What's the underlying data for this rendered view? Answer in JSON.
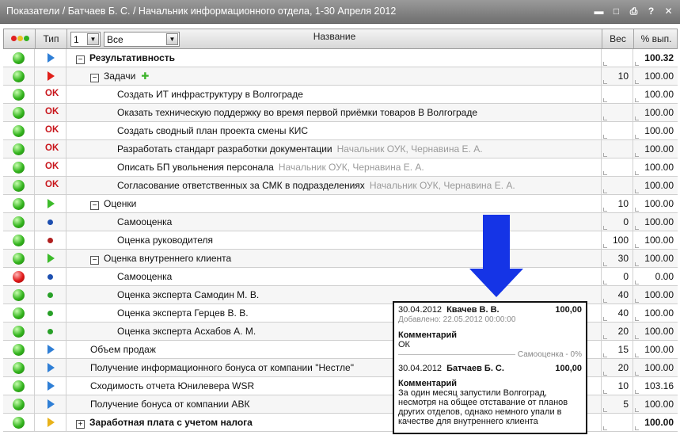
{
  "window": {
    "title": "Показатели / Батчаев Б. С. / Начальник информационного отдела, 1-30 Апреля 2012",
    "controls": [
      "▬",
      "□",
      "⎙",
      "?",
      "✕"
    ]
  },
  "header": {
    "type_label": "Тип",
    "level_value": "1",
    "filter_value": "Все",
    "name_label": "Название",
    "weight_label": "Вес",
    "pct_label": "% вып."
  },
  "rows": [
    {
      "status": "green",
      "type": "flag-blue",
      "level": 0,
      "toggle": "−",
      "name": "Результативность",
      "bold": true,
      "weight": "",
      "pct": "100.32",
      "pct_bold": true
    },
    {
      "status": "green",
      "type": "flag-red",
      "level": 1,
      "toggle": "−",
      "name": "Задачи",
      "plus": "✚",
      "weight": "10",
      "pct": "100.00"
    },
    {
      "status": "green",
      "type": "ok",
      "ok_text": "OK",
      "level": 2,
      "name": "Создать ИТ инфраструктуру в Волгограде",
      "weight": "",
      "pct": "100.00"
    },
    {
      "status": "green",
      "type": "ok",
      "ok_text": "OK",
      "level": 2,
      "name": "Оказать техническую поддержку во время первой приёмки товаров В Волгограде",
      "weight": "",
      "pct": "100.00"
    },
    {
      "status": "green",
      "type": "ok",
      "ok_text": "OK",
      "level": 2,
      "name": "Создать сводный план проекта смены КИС",
      "weight": "",
      "pct": "100.00"
    },
    {
      "status": "green",
      "type": "ok",
      "ok_text": "OK",
      "level": 2,
      "name": "Разработать стандарт разработки документации",
      "resp": "Начальник ОУК, Чернавина Е. А.",
      "weight": "",
      "pct": "100.00"
    },
    {
      "status": "green",
      "type": "ok",
      "ok_text": "OK",
      "level": 2,
      "name": "Описать БП увольнения персонала",
      "resp": "Начальник ОУК, Чернавина Е. А.",
      "weight": "",
      "pct": "100.00"
    },
    {
      "status": "green",
      "type": "ok",
      "ok_text": "OK",
      "level": 2,
      "name": "Согласование ответственных за СМК в подразделениях",
      "resp": "Начальник ОУК, Чернавина Е. А.",
      "weight": "",
      "pct": "100.00"
    },
    {
      "status": "green",
      "type": "flag-green",
      "level": 1,
      "toggle": "−",
      "name": "Оценки",
      "weight": "10",
      "pct": "100.00"
    },
    {
      "status": "green",
      "type": "dot-blue",
      "level": 2,
      "name": "Самооценка",
      "weight": "0",
      "pct": "100.00"
    },
    {
      "status": "green",
      "type": "dot-red",
      "level": 2,
      "name": "Оценка руководителя",
      "weight": "100",
      "pct": "100.00"
    },
    {
      "status": "green",
      "type": "flag-green",
      "level": 1,
      "toggle": "−",
      "name": "Оценка внутреннего клиента",
      "weight": "30",
      "pct": "100.00"
    },
    {
      "status": "red",
      "type": "dot-blue",
      "level": 2,
      "name": "Самооценка",
      "weight": "0",
      "pct": "0.00"
    },
    {
      "status": "green",
      "type": "dot-green",
      "level": 2,
      "name": "Оценка эксперта Самодин М. В.",
      "weight": "40",
      "pct": "100.00"
    },
    {
      "status": "green",
      "type": "dot-green",
      "level": 2,
      "name": "Оценка эксперта Герцев В. В.",
      "weight": "40",
      "pct": "100.00"
    },
    {
      "status": "green",
      "type": "dot-green",
      "level": 2,
      "name": "Оценка эксперта Асхабов А. М.",
      "weight": "20",
      "pct": "100.00"
    },
    {
      "status": "green",
      "type": "flag-blue",
      "level": 1,
      "name": "Объем продаж",
      "weight": "15",
      "pct": "100.00"
    },
    {
      "status": "green",
      "type": "flag-blue",
      "level": 1,
      "name": "Получение информационного бонуса от компании \"Нестле\"",
      "weight": "20",
      "pct": "100.00"
    },
    {
      "status": "green",
      "type": "flag-blue",
      "level": 1,
      "name": "Сходимость отчета Юнилевера WSR",
      "weight": "10",
      "pct": "103.16"
    },
    {
      "status": "green",
      "type": "flag-blue",
      "level": 1,
      "name": "Получение бонуса от компании АВК",
      "weight": "5",
      "pct": "100.00"
    },
    {
      "status": "green",
      "type": "flag-yellow",
      "level": 0,
      "toggle": "+",
      "name": "Заработная плата с учетом налога",
      "bold": true,
      "weight": "",
      "pct": "100.00",
      "pct_bold": true
    }
  ],
  "popup": {
    "entry1": {
      "date": "30.04.2012",
      "author": "Квачев В. В.",
      "value": "100,00",
      "added": "Добавлено: 22.05.2012 00:00:00",
      "comment_title": "Комментарий",
      "comment": "ОК"
    },
    "separator": "Самооценка - 0%",
    "entry2": {
      "date": "30.04.2012",
      "author": "Батчаев Б. С.",
      "value": "100,00",
      "comment_title": "Комментарий",
      "comment": "За один месяц запустили Волгоград, несмотря на общее отставание от планов других отделов, однако немного упали в качестве для внутреннего клиента"
    }
  },
  "colors": {
    "titlebar": "#7f7f7f",
    "status_green": "#33b41d",
    "status_red": "#e01818",
    "ok_red": "#c8141a",
    "pointer_blue": "#1534e6"
  }
}
